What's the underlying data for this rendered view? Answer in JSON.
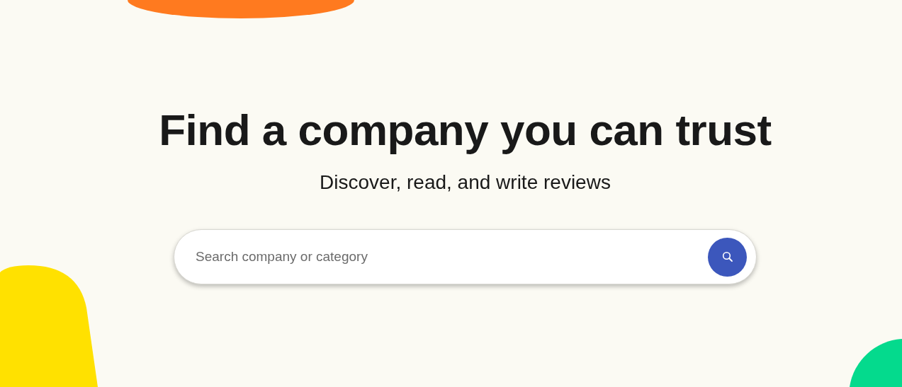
{
  "hero": {
    "heading": "Find a company you can trust",
    "subheading": "Discover, read, and write reviews"
  },
  "search": {
    "placeholder": "Search company or category"
  }
}
